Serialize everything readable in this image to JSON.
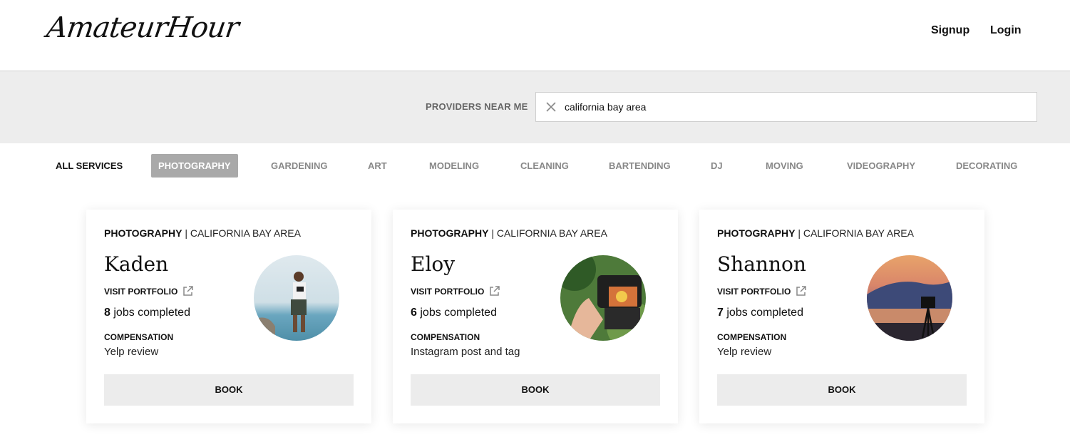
{
  "header": {
    "logo": "AmateurHour",
    "nav": {
      "signup": "Signup",
      "login": "Login"
    }
  },
  "search": {
    "label": "PROVIDERS NEAR ME",
    "value": "california bay area",
    "clear_icon": "close-icon"
  },
  "tabs": [
    {
      "label": "ALL SERVICES"
    },
    {
      "label": "PHOTOGRAPHY",
      "selected": true
    },
    {
      "label": "GARDENING"
    },
    {
      "label": "ART"
    },
    {
      "label": "MODELING"
    },
    {
      "label": "CLEANING"
    },
    {
      "label": "BARTENDING"
    },
    {
      "label": "DJ"
    },
    {
      "label": "MOVING"
    },
    {
      "label": "VIDEOGRAPHY"
    },
    {
      "label": "DECORATING"
    }
  ],
  "colors": {
    "selected_tab": "#a9a9a9",
    "search_band": "#ededed",
    "button": "#ececec"
  },
  "cards": [
    {
      "category": "PHOTOGRAPHY",
      "location": "| CALIFORNIA BAY AREA",
      "name": "Kaden",
      "portfolio_label": "VISIT PORTFOLIO",
      "portfolio_icon": "external-link-icon",
      "jobs_count": "8",
      "jobs_suffix": "jobs completed",
      "compensation_label": "COMPENSATION",
      "compensation": "Yelp review",
      "book_label": "BOOK"
    },
    {
      "category": "PHOTOGRAPHY",
      "location": "| CALIFORNIA BAY AREA",
      "name": "Eloy",
      "portfolio_label": "VISIT PORTFOLIO",
      "portfolio_icon": "external-link-icon",
      "jobs_count": "6",
      "jobs_suffix": "jobs completed",
      "compensation_label": "COMPENSATION",
      "compensation": "Instagram post and tag",
      "book_label": "BOOK"
    },
    {
      "category": "PHOTOGRAPHY",
      "location": "| CALIFORNIA BAY AREA",
      "name": "Shannon",
      "portfolio_label": "VISIT PORTFOLIO",
      "portfolio_icon": "external-link-icon",
      "jobs_count": "7",
      "jobs_suffix": "jobs completed",
      "compensation_label": "COMPENSATION",
      "compensation": "Yelp review",
      "book_label": "BOOK"
    }
  ]
}
